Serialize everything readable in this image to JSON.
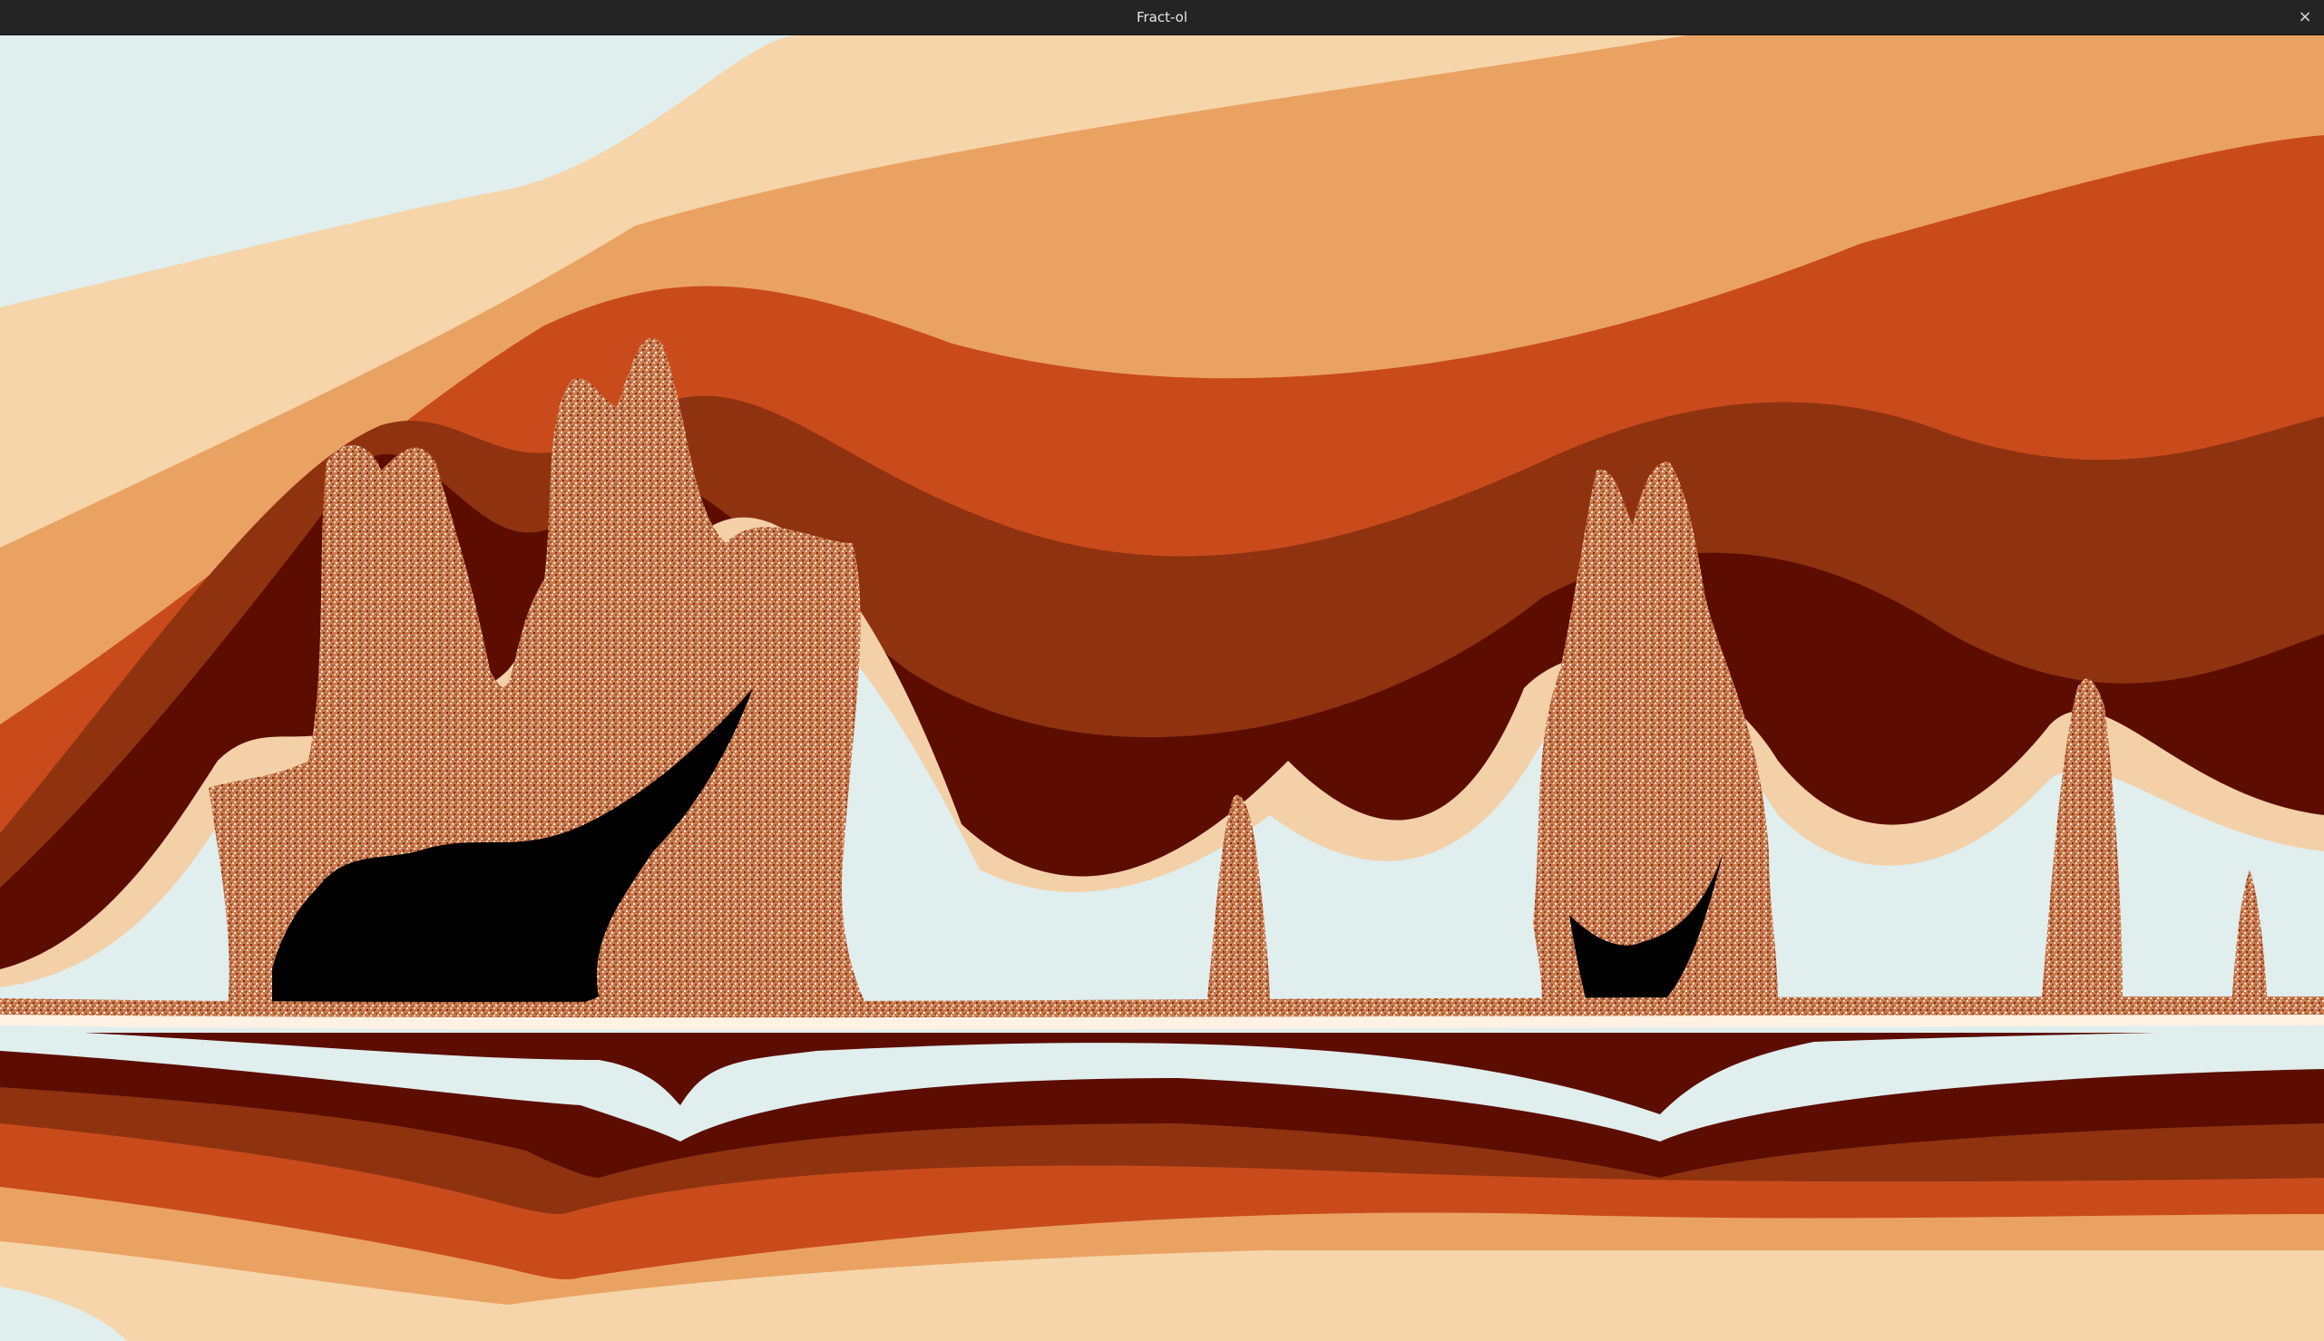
{
  "window": {
    "title": "Fract-ol",
    "close_glyph": "×",
    "close_icon": "close-icon"
  },
  "palette": {
    "ice": "#e0eeee",
    "sand": "#f5d5a9",
    "tan": "#eaa263",
    "rust": "#c94b1b",
    "brown": "#8f3210",
    "maroon": "#5c0d00",
    "fractal_texture": "#c97a4f",
    "set_interior": "#000000"
  }
}
